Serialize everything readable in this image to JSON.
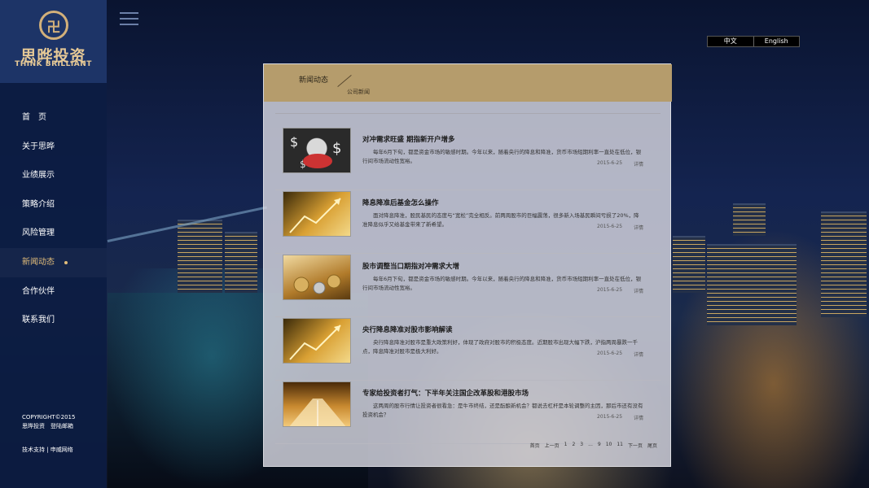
{
  "brand": {
    "cn": "思晔投资",
    "en": "THINK BRILLIANT"
  },
  "nav": {
    "items": [
      {
        "label": "首　页"
      },
      {
        "label": "关于思晔"
      },
      {
        "label": "业绩展示"
      },
      {
        "label": "策略介绍"
      },
      {
        "label": "风险管理"
      },
      {
        "label": "新闻动态"
      },
      {
        "label": "合作伙伴"
      },
      {
        "label": "联系我们"
      }
    ],
    "active_index": 5
  },
  "footer": {
    "copyright": "COPYRIGHT©2015",
    "company": "思晔投资　登陆邮箱",
    "support": "技术支持 | 申威网络"
  },
  "lang": {
    "zh": "中文",
    "en": "English"
  },
  "panel": {
    "title": "新闻动态",
    "subtitle": "公司新闻",
    "news": [
      {
        "title": "对冲需求旺盛  期指新开户增多",
        "body": "每年6月下旬，都是资金市场的敏感时期。今年以来，随着央行的降息和降准，货币市场短期利率一直处在低位，银行间市场流动性宽裕。",
        "date": "2015-6-25",
        "more": "详情",
        "thumb": "money-bag"
      },
      {
        "title": "降息降准后基金怎么操作",
        "body": "面对降息降准，股民基民的态度与“宽松”完全相反。前两周股市的巨幅震荡，很多新入场基民瞬间亏损了20%，降准降息似乎又给基金带来了新希望。",
        "date": "2015-6-25",
        "more": "详情",
        "thumb": "rising-arrows"
      },
      {
        "title": "股市调整当口期指对冲需求大增",
        "body": "每年6月下旬，都是资金市场的敏感时期。今年以来，随着央行的降息和降准，货币市场短期利率一直处在低位，银行间市场流动性宽裕。",
        "date": "2015-6-25",
        "more": "详情",
        "thumb": "coins"
      },
      {
        "title": "央行降息降准对股市影响解读",
        "body": "央行降息降准对股市是重大政策利好，体现了政府对股市的积极态度。近期股市出现大幅下跌，沪指两周暴跌一千点，降息降准对股市是极大利好。",
        "date": "2015-6-25",
        "more": "详情",
        "thumb": "rising-arrows"
      },
      {
        "title": "专家给投资者打气：下半年关注国企改革股和港股市场",
        "body": "这两周的股市行情让投资者很看急：是牛市终结，还是酝酿新机会？都说去杠杆是本轮调整的主因，那后市还有没有投资机会？",
        "date": "2015-6-25",
        "more": "详情",
        "thumb": "road"
      }
    ],
    "pager": [
      "首页",
      "上一页",
      "1",
      "2",
      "3",
      "...",
      "9",
      "10",
      "11",
      "下一页",
      "尾页"
    ]
  },
  "colors": {
    "sidebar": "#0c1c42",
    "logo_bg": "#1d3467",
    "gold": "#e2bd7a",
    "panel_head": "#b59c6c"
  }
}
